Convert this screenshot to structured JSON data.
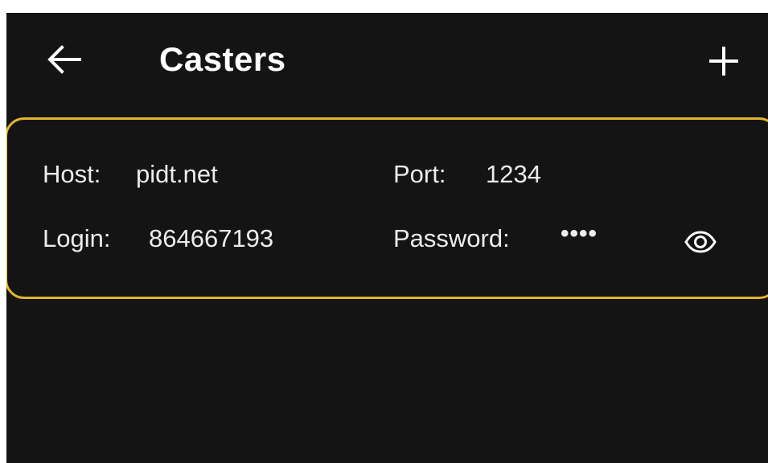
{
  "app_bar": {
    "back_icon": "arrow-left-icon",
    "title": "Casters",
    "add_icon": "plus-icon"
  },
  "caster": {
    "host_label": "Host:",
    "host_value": "pidt.net",
    "port_label": "Port:",
    "port_value": "1234",
    "login_label": "Login:",
    "login_value": "864667193",
    "password_label": "Password:",
    "password_value": "••••",
    "visibility_icon": "eye-icon"
  },
  "colors": {
    "background": "#141414",
    "text": "#ffffff",
    "card_border": "#e1b52e"
  }
}
